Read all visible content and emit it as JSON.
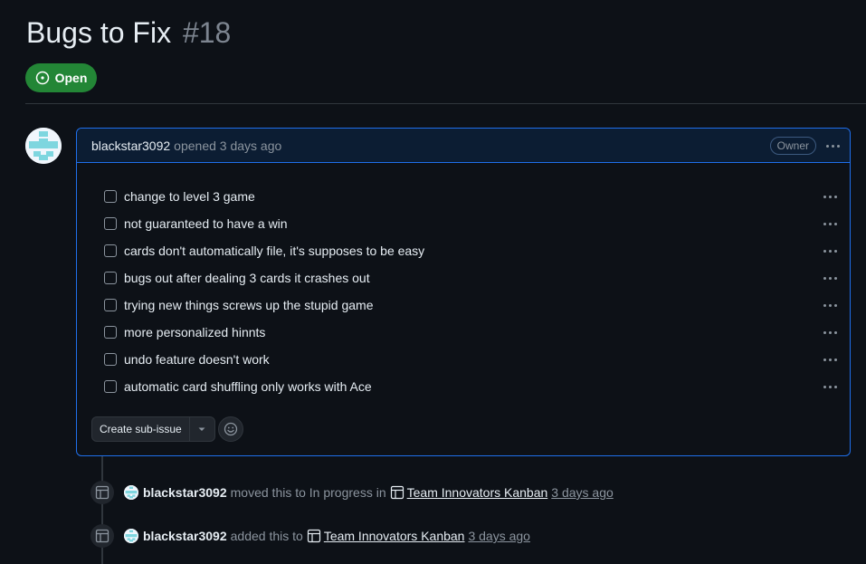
{
  "issue": {
    "title": "Bugs to Fix",
    "number": "#18",
    "state": "Open",
    "state_color": "#238636"
  },
  "comment": {
    "author": "blackstar3092",
    "opened_text": "opened 3 days ago",
    "role_badge": "Owner",
    "tasks": [
      {
        "label": "change to level 3 game",
        "checked": false
      },
      {
        "label": "not guaranteed to have a win",
        "checked": false
      },
      {
        "label": "cards don't automatically file, it's supposes to be easy",
        "checked": false
      },
      {
        "label": "bugs out after dealing 3 cards it crashes out",
        "checked": false
      },
      {
        "label": "trying new things screws up the stupid game",
        "checked": false
      },
      {
        "label": "more personalized hinnts",
        "checked": false
      },
      {
        "label": "undo feature doesn't work",
        "checked": false
      },
      {
        "label": "automatic card shuffling only works with Ace",
        "checked": false
      }
    ],
    "create_sub_issue_label": "Create sub-issue"
  },
  "timeline": [
    {
      "actor": "blackstar3092",
      "text": "moved this to In progress in",
      "project": "Team Innovators Kanban",
      "time": "3 days ago"
    },
    {
      "actor": "blackstar3092",
      "text": "added this to",
      "project": "Team Innovators Kanban",
      "time": "3 days ago"
    }
  ],
  "colors": {
    "accent_border": "#1f6feb",
    "background": "#0d1117"
  }
}
